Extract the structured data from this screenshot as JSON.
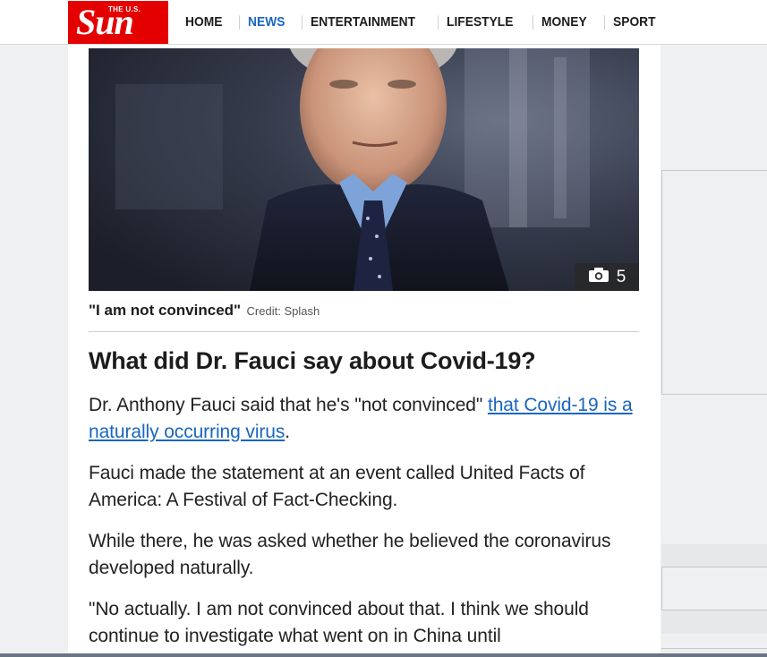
{
  "header": {
    "logo": {
      "small_text": "THE U.S.",
      "big_text": "Sun",
      "color": "#e50000"
    },
    "nav": [
      {
        "label": "HOME",
        "active": false
      },
      {
        "label": "NEWS",
        "active": true
      },
      {
        "label": "ENTERTAINMENT",
        "active": false
      },
      {
        "label": "LIFESTYLE",
        "active": false
      },
      {
        "label": "MONEY",
        "active": false
      },
      {
        "label": "SPORT",
        "active": false
      }
    ]
  },
  "article": {
    "hero": {
      "icon": "camera-icon",
      "photo_count": "5"
    },
    "caption": {
      "quote": "\"I am not convinced\"",
      "credit": "Credit: Splash"
    },
    "headline": "What did Dr. Fauci say about Covid-19?",
    "paragraphs": {
      "p1_text": "Dr. Anthony Fauci said that he's \"not convinced\" ",
      "p1_link": "that Covid-19 is a naturally occurring virus",
      "p1_end": ".",
      "p2": "Fauci made the statement at an event called United Facts of America: A Festival of Fact-Checking.",
      "p3": "While there, he was asked whether he believed the coronavirus developed naturally.",
      "p4": "\"No actually. I am not convinced about that. I think we should continue to investigate what went on in China until"
    },
    "link_color": "#1a66c0"
  }
}
